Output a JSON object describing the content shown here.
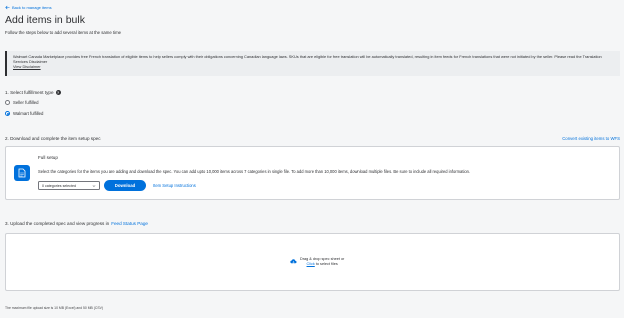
{
  "header": {
    "back_label": "Back to manage items",
    "title": "Add items in bulk",
    "subtitle": "Follow the steps below to add several items at the same time"
  },
  "notice": {
    "text": "Walmart Canada Marketplace provides free French translation of eligible items to help sellers comply with their obligations concerning Canadian language laws. SKUs that are eligible for free translation will be automatically translated, resulting in item feeds for French translations that were not initiated by the seller. Please read the Translation Services Disclaimer",
    "link_label": "View Disclaimer"
  },
  "step1": {
    "label": "1. Select fulfillment type",
    "options": [
      {
        "label": "Seller fulfilled",
        "checked": false
      },
      {
        "label": "Walmart fulfilled",
        "checked": true
      }
    ]
  },
  "step2": {
    "label": "2. Download and complete the item setup spec",
    "convert_link": "Convert existing items to WFS",
    "card": {
      "title": "Full setup",
      "description": "Select the categories for the items you are adding and download the spec. You can add upto 10,000 items across 7 categories in single file. To add more than 10,000 items, download multiple files. Be sure to include all required information.",
      "select_value": "0 categories selected",
      "download_label": "Download",
      "instructions_label": "Item Setup Instructions"
    }
  },
  "step3": {
    "label_prefix": "3. Upload the completed spec and view progress in",
    "label_link": "Feed Status Page",
    "drop_line1": "Drag & drop spec sheet or",
    "drop_link": "Click",
    "drop_line2_suffix": " to select files"
  },
  "footnote": "The maximum file upload size is 10 MB (Excel) and 50 MB (CSV)",
  "colors": {
    "accent": "#0071dc",
    "text": "#2e2f32",
    "background": "#f5f6f7"
  }
}
